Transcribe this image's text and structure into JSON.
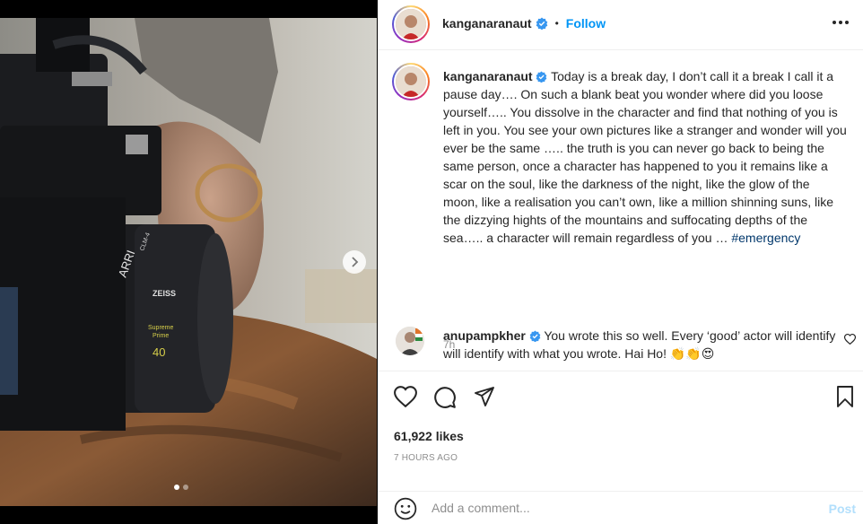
{
  "post": {
    "username": "kanganaranaut",
    "separator": "•",
    "follow_label": "Follow",
    "caption": {
      "username": "kanganaranaut",
      "text": "Today is a break day, I don’t call it a break I call it a pause day…. On such a blank beat you wonder where did you loose yourself….. You dissolve in the character and find that nothing of you is left in you. You see your own pictures like a stranger and wonder will you ever be the same ….. the truth is you can never go back to being the same person, once a character has happened to you it remains like a scar on the soul, like the darkness of the night, like the glow of the moon, like a realisation you can’t own, like a million shinning suns, like the dizzying hights of the mountains and suffocating depths of the sea….. a character will remain regardless of you …",
      "hashtag": "#emergency",
      "time": "7h"
    },
    "comment": {
      "username": "anupampkher",
      "text": "You wrote this so well. Every ‘good’ actor will identify will identify with what you wrote. Hai Ho! 👏👏😍"
    },
    "likes": "61,922 likes",
    "posted_ago": "7 HOURS AGO",
    "add_comment_placeholder": "Add a comment...",
    "post_label": "Post"
  },
  "media": {
    "lens_text_brand": "ARRI",
    "lens_text_model": "CLM-4",
    "lens_maker": "ZEISS",
    "lens_series_1": "Supreme",
    "lens_series_2": "Prime",
    "lens_focal": "40",
    "carousel_dots": 2,
    "carousel_active": 1
  },
  "colors": {
    "accent": "#0095f6",
    "verified": "#3897f0",
    "hashtag": "#00376b",
    "muted": "#8e8e8e"
  },
  "icons": [
    "more-icon",
    "verified-icon",
    "heart-icon",
    "comment-icon",
    "share-icon",
    "bookmark-icon",
    "emoji-icon",
    "chevron-right-icon"
  ]
}
